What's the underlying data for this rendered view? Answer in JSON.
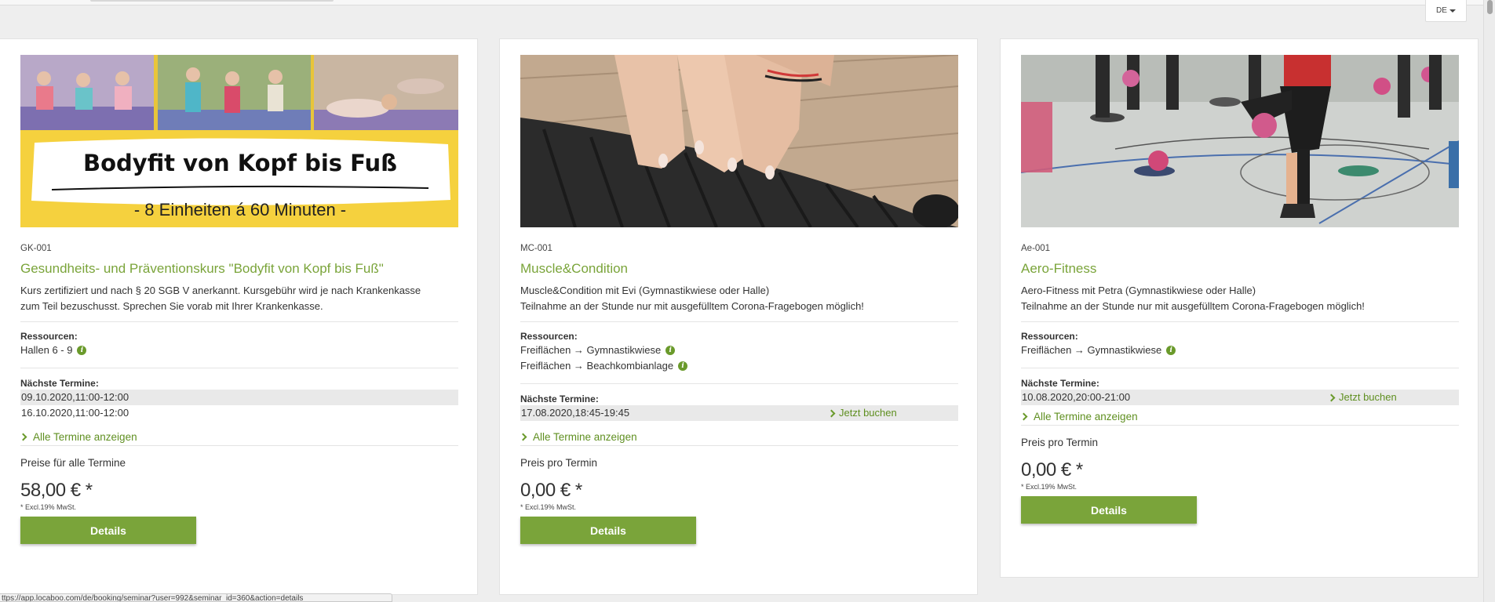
{
  "header": {
    "language": "DE"
  },
  "status_url": "ttps://app.locaboo.com/de/booking/seminar?user=992&seminar_id=360&action=details",
  "banner": {
    "headline": "Bodyfit von Kopf bis Fuß",
    "subline": "- 8 Einheiten á 60 Minuten -"
  },
  "courses": [
    {
      "code": "GK-001",
      "title": "Gesundheits- und Präventionskurs \"Bodyfit von Kopf bis Fuß\"",
      "desc1": "Kurs zertifiziert und nach § 20 SGB V anerkannt. Kursgebühr wird je nach Krankenkasse",
      "desc2": "zum Teil bezuschusst. Sprechen Sie vorab mit Ihrer Krankenkasse.",
      "resources_label": "Ressourcen:",
      "resources": [
        "Hallen 6 - 9"
      ],
      "dates_label": "Nächste Termine:",
      "dates": [
        "09.10.2020,11:00-12:00",
        "16.10.2020,11:00-12:00"
      ],
      "all_dates": "Alle Termine anzeigen",
      "price_label": "Preise für alle Termine",
      "price": "58,00 € *",
      "vat": "* Excl.19% MwSt.",
      "details": "Details"
    },
    {
      "code": "MC-001",
      "title": "Muscle&Condition",
      "desc1": "Muscle&Condition mit Evi (Gymnastikwiese oder Halle)",
      "desc2": "Teilnahme an der Stunde nur mit ausgefülltem Corona-Fragebogen möglich!",
      "resources_label": "Ressourcen:",
      "resources": [
        "Freiflächen → Gymnastikwiese",
        "Freiflächen → Beachkombianlage"
      ],
      "dates_label": "Nächste Termine:",
      "dates": [
        "17.08.2020,18:45-19:45"
      ],
      "book": "Jetzt buchen",
      "all_dates": "Alle Termine anzeigen",
      "price_label": "Preis pro Termin",
      "price": "0,00 € *",
      "vat": "* Excl.19% MwSt.",
      "details": "Details"
    },
    {
      "code": "Ae-001",
      "title": "Aero-Fitness",
      "desc1": "Aero-Fitness mit Petra (Gymnastikwiese oder Halle)",
      "desc2": "Teilnahme an der Stunde nur mit ausgefülltem Corona-Fragebogen möglich!",
      "resources_label": "Ressourcen:",
      "resources": [
        "Freiflächen → Gymnastikwiese"
      ],
      "dates_label": "Nächste Termine:",
      "dates": [
        "10.08.2020,20:00-21:00"
      ],
      "book": "Jetzt buchen",
      "all_dates": "Alle Termine anzeigen",
      "price_label": "Preis pro Termin",
      "price": "0,00 € *",
      "vat": "* Excl.19% MwSt.",
      "details": "Details"
    }
  ]
}
